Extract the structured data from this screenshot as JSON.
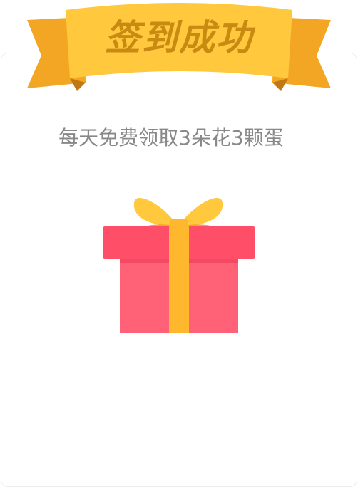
{
  "banner": {
    "title": "签到成功"
  },
  "message": {
    "text": "每天免费领取3朵花3颗蛋"
  },
  "colors": {
    "ribbon_gold": "#ffc83d",
    "ribbon_dark": "#f2a623",
    "title_text": "#c98a12",
    "gift_lid": "#ff4f68",
    "gift_box": "#ff6277",
    "gift_ribbon": "#ffb82e",
    "subtitle_text": "#888888"
  },
  "icons": {
    "gift": "gift-box-icon"
  }
}
